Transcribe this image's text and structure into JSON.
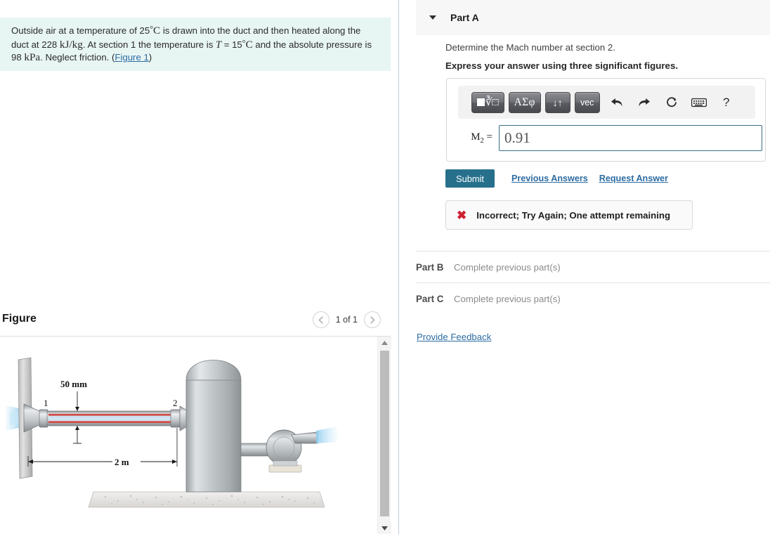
{
  "problem": {
    "segment1": "Outside air at a temperature of 25",
    "degree": "°",
    "unit_c1": "C",
    "segment2": " is drawn into the duct and then heated along the duct at 228 ",
    "unit_kjkg": "kJ/kg",
    "segment3": ". At section 1 the temperature is ",
    "var_T": "T",
    "segment4": " = 15",
    "unit_c2": "C",
    "segment5": " and the absolute pressure is 98 ",
    "unit_kpa": "kPa",
    "segment6": ". Neglect friction. (",
    "figure_link": "Figure 1",
    "segment7": ")"
  },
  "figure": {
    "title": "Figure",
    "counter": "1 of 1",
    "prev_icon": "chevron-left-icon",
    "next_icon": "chevron-right-icon",
    "labels": {
      "diameter": "50 mm",
      "length": "2 m",
      "section1": "1",
      "section2": "2"
    },
    "scrollbar": {
      "up_icon": "triangle-up-icon",
      "down_icon": "triangle-down-icon"
    }
  },
  "part_a": {
    "label": "Part A",
    "caret_icon": "caret-down-icon",
    "prompt": "Determine the Mach number at section 2.",
    "instruction": "Express your answer using three significant figures.",
    "toolbar": {
      "template_label": "■√□",
      "greek_label": "ΑΣφ",
      "arrows_label": "↓↑",
      "vec_label": "vec",
      "undo_icon": "undo-arrow-icon",
      "redo_icon": "redo-arrow-icon",
      "reset_icon": "reset-circular-arrow-icon",
      "keyboard_icon": "keyboard-icon",
      "help_label": "?"
    },
    "answer": {
      "label_var": "M",
      "label_sub": "2",
      "label_eq": " =",
      "value": "0.91",
      "placeholder": ""
    },
    "submit_label": "Submit",
    "previous_answers_label": "Previous Answers",
    "request_answer_label": "Request Answer",
    "feedback": {
      "icon": "x-mark-icon",
      "text": "Incorrect; Try Again; One attempt remaining"
    }
  },
  "part_b": {
    "name": "Part B",
    "status": "Complete previous part(s)"
  },
  "part_c": {
    "name": "Part C",
    "status": "Complete previous part(s)"
  },
  "provide_feedback_label": "Provide Feedback",
  "colors": {
    "problem_bg": "#e7f5f3",
    "accent_link": "#2d6ca2",
    "submit_bg": "#27708c",
    "error_red": "#cf2031",
    "header_bg": "#f7f7f7",
    "input_border": "#3c6e83"
  }
}
